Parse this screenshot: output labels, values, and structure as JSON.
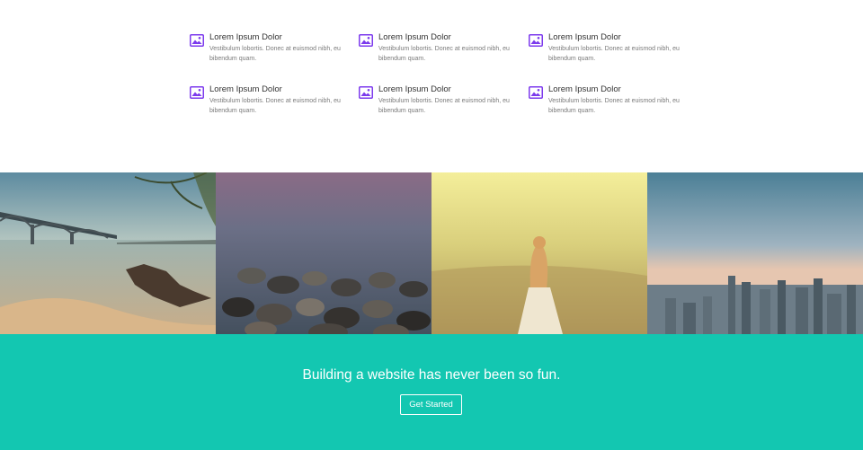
{
  "features": [
    {
      "title": "Lorem Ipsum Dolor",
      "desc": "Vestibulum lobortis. Donec at euismod nibh, eu bibendum quam."
    },
    {
      "title": "Lorem Ipsum Dolor",
      "desc": "Vestibulum lobortis. Donec at euismod nibh, eu bibendum quam."
    },
    {
      "title": "Lorem Ipsum Dolor",
      "desc": "Vestibulum lobortis. Donec at euismod nibh, eu bibendum quam."
    },
    {
      "title": "Lorem Ipsum Dolor",
      "desc": "Vestibulum lobortis. Donec at euismod nibh, eu bibendum quam."
    },
    {
      "title": "Lorem Ipsum Dolor",
      "desc": "Vestibulum lobortis. Donec at euismod nibh, eu bibendum quam."
    },
    {
      "title": "Lorem Ipsum Dolor",
      "desc": "Vestibulum lobortis. Donec at euismod nibh, eu bibendum quam."
    }
  ],
  "icons": {
    "feature": "image-icon"
  },
  "gallery": [
    {
      "subject": "bridge over river at sunset"
    },
    {
      "subject": "pebbles on shore"
    },
    {
      "subject": "girl in golden field"
    },
    {
      "subject": "city skyline at dusk"
    }
  ],
  "cta": {
    "headline": "Building a website has never been so fun.",
    "button_label": "Get Started"
  },
  "colors": {
    "accent": "#13c7b1",
    "icon": "#7c3aed"
  }
}
